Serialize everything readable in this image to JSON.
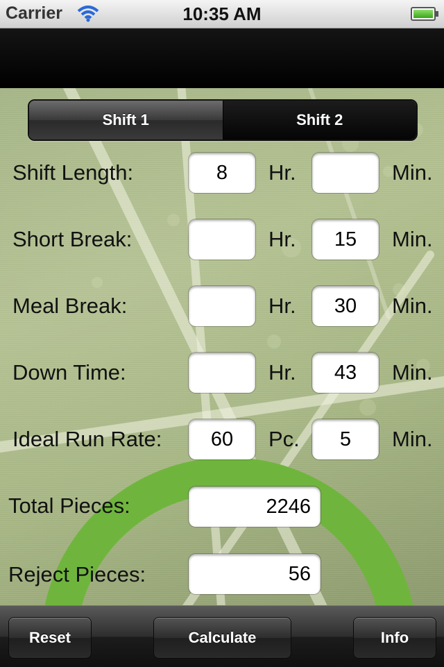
{
  "status": {
    "carrier": "Carrier",
    "time": "10:35 AM"
  },
  "tabs": [
    {
      "label": "Shift 1",
      "selected": false
    },
    {
      "label": "Shift 2",
      "selected": true
    }
  ],
  "rows": {
    "shift_length": {
      "label": "Shift Length:",
      "hr": "8",
      "hr_unit": "Hr.",
      "min": "",
      "min_unit": "Min."
    },
    "short_break": {
      "label": "Short Break:",
      "hr": "",
      "hr_unit": "Hr.",
      "min": "15",
      "min_unit": "Min."
    },
    "meal_break": {
      "label": "Meal Break:",
      "hr": "",
      "hr_unit": "Hr.",
      "min": "30",
      "min_unit": "Min."
    },
    "down_time": {
      "label": "Down Time:",
      "hr": "",
      "hr_unit": "Hr.",
      "min": "43",
      "min_unit": "Min."
    },
    "ideal_run_rate": {
      "label": "Ideal Run Rate:",
      "pc": "60",
      "pc_unit": "Pc.",
      "min": "5",
      "min_unit": "Min."
    }
  },
  "totals": {
    "total_pieces": {
      "label": "Total Pieces:",
      "value": "2246"
    },
    "reject_pieces": {
      "label": "Reject Pieces:",
      "value": "56"
    }
  },
  "toolbar": {
    "reset_label": "Reset",
    "calculate_label": "Calculate",
    "info_label": "Info"
  },
  "colors": {
    "accent_green": "#6fb53d",
    "background": "#a8b888"
  }
}
